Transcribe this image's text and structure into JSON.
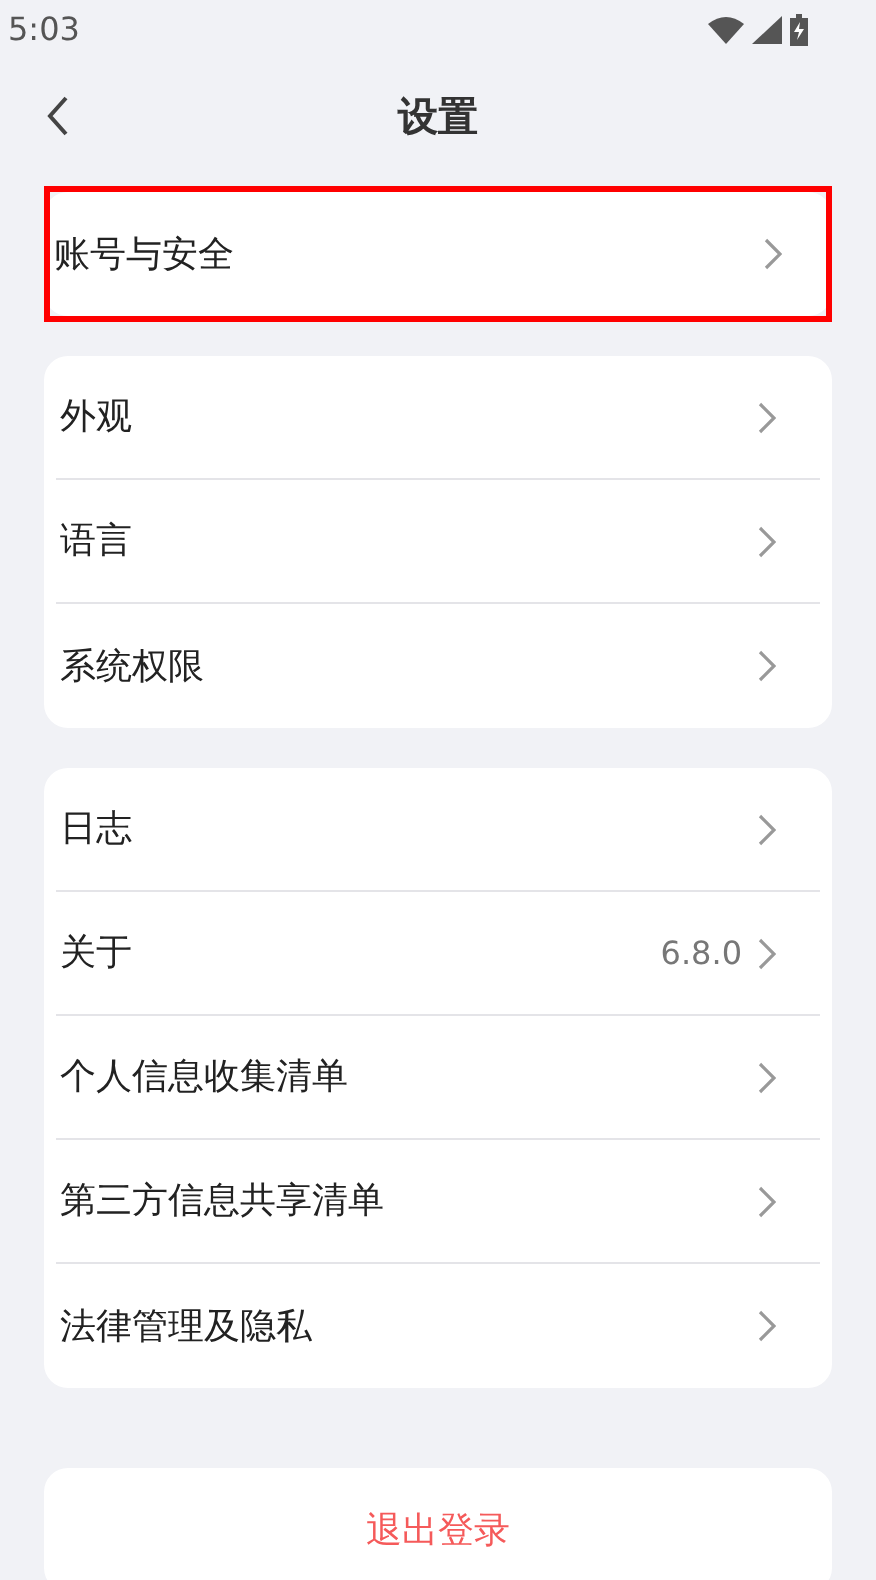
{
  "status_bar": {
    "time": "5:03"
  },
  "header": {
    "title": "设置"
  },
  "groups": [
    {
      "items": [
        {
          "label": "账号与安全",
          "highlighted": true
        }
      ]
    },
    {
      "items": [
        {
          "label": "外观",
          "highlighted": false
        },
        {
          "label": "语言",
          "highlighted": false
        },
        {
          "label": "系统权限",
          "highlighted": false
        }
      ]
    },
    {
      "items": [
        {
          "label": "日志",
          "highlighted": false
        },
        {
          "label": "关于",
          "value": "6.8.0",
          "highlighted": false
        },
        {
          "label": "个人信息收集清单",
          "highlighted": false
        },
        {
          "label": "第三方信息共享清单",
          "highlighted": false
        },
        {
          "label": "法律管理及隐私",
          "highlighted": false
        }
      ]
    }
  ],
  "logout": {
    "label": "退出登录"
  }
}
